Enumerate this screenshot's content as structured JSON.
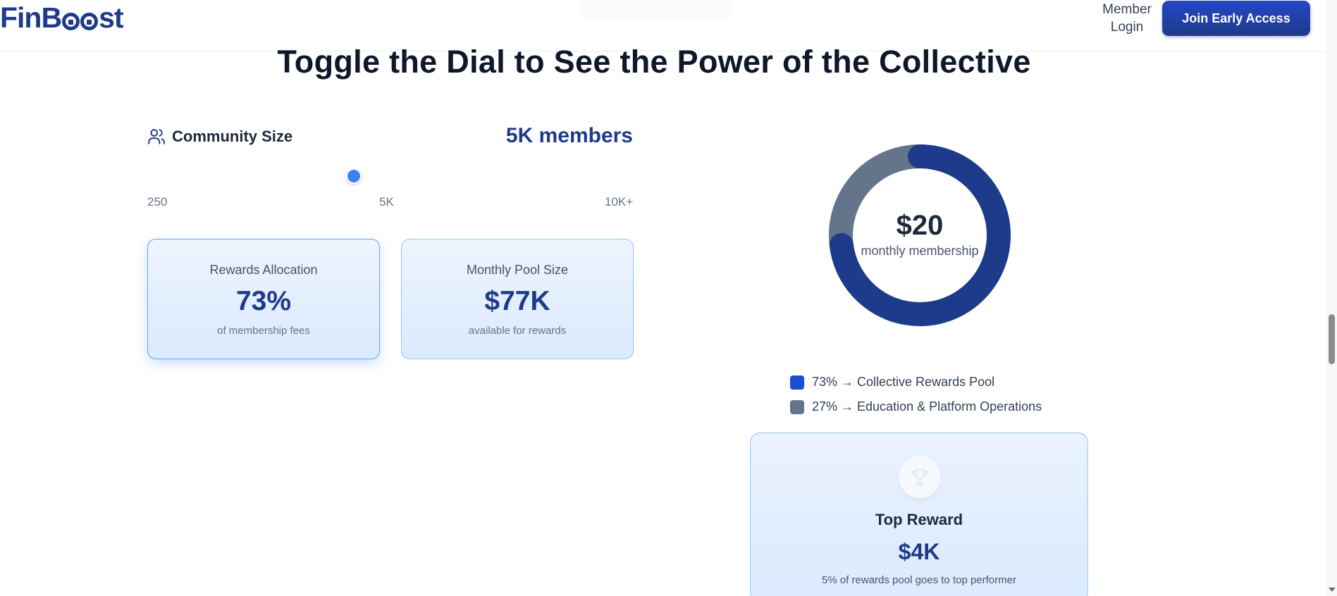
{
  "header": {
    "logo_prefix": "FinB",
    "logo_suffix": "st",
    "member_login": "Member Login",
    "cta_label": "Join Early Access"
  },
  "page_title": "Toggle the Dial to See the Power of the Collective",
  "community": {
    "icon": "users-icon",
    "label": "Community Size",
    "value_display": "5K members",
    "slider": {
      "min_label": "250",
      "mid_label": "5K",
      "max_label": "10K+",
      "position_fraction": 0.425
    }
  },
  "stats": [
    {
      "label": "Rewards Allocation",
      "value": "73%",
      "sub": "of membership fees"
    },
    {
      "label": "Monthly Pool Size",
      "value": "$77K",
      "sub": "available for rewards"
    }
  ],
  "donut": {
    "amount": "$20",
    "caption": "monthly membership",
    "segments": [
      {
        "label": "73% → Collective Rewards Pool",
        "percent": 73,
        "color": "#1e3a8a",
        "swatch": "#1d4ed8"
      },
      {
        "label": "27% → Education & Platform Operations",
        "percent": 27,
        "color": "#64748b",
        "swatch": "#64748b"
      }
    ]
  },
  "top_reward": {
    "icon": "trophy-icon",
    "title": "Top Reward",
    "value": "$4K",
    "sub": "5% of rewards pool goes to top performer"
  },
  "colors": {
    "brand_navy": "#1e3a8a",
    "accent_blue": "#3b82f6",
    "card_fill": "#dbeafe",
    "muted_slate": "#64748b"
  }
}
